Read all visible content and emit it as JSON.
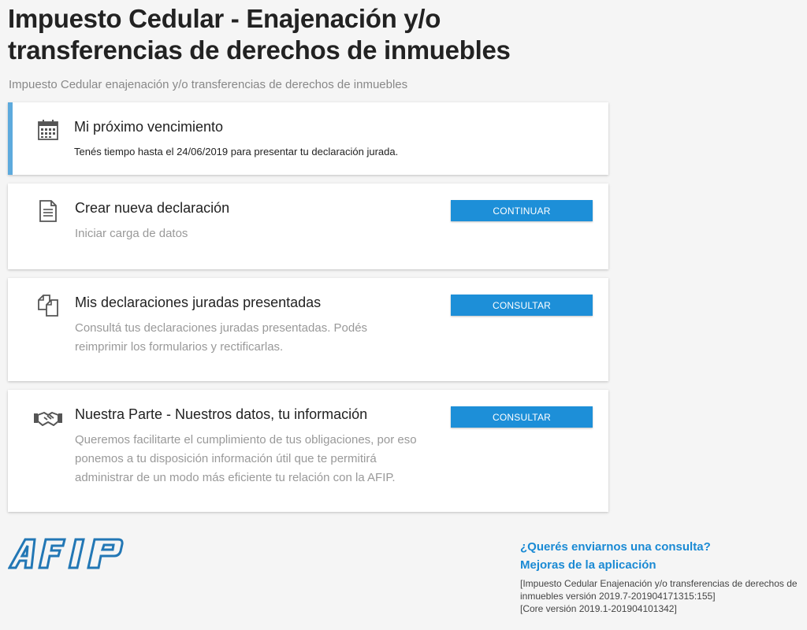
{
  "page": {
    "title": "Impuesto Cedular - Enajenación y/o transferencias de derechos de inmuebles",
    "subtitle": "Impuesto Cedular enajenación y/o transferencias de derechos de inmuebles"
  },
  "cards": [
    {
      "icon": "calendar-icon",
      "title": "Mi próximo vencimiento",
      "description": "Tenés tiempo hasta el 24/06/2019 para presentar tu declaración jurada."
    },
    {
      "icon": "document-icon",
      "title": "Crear nueva declaración",
      "description": "Iniciar carga de datos",
      "button": "CONTINUAR"
    },
    {
      "icon": "copy-documents-icon",
      "title": "Mis declaraciones juradas presentadas",
      "description": "Consultá tus declaraciones juradas presentadas. Podés reimprimir los formularios y rectificarlas.",
      "button": "CONSULTAR"
    },
    {
      "icon": "handshake-icon",
      "title": "Nuestra Parte - Nuestros datos, tu información",
      "description": "Queremos facilitarte el cumplimiento de tus obligaciones, por eso ponemos a tu disposición información útil que te permitirá administrar de un modo más eficiente tu relación con la AFIP.",
      "button": "CONSULTAR"
    }
  ],
  "footer": {
    "logo_text": "AFIP",
    "consulta_link": "¿Querés enviarnos una consulta?",
    "mejoras_link": "Mejoras de la aplicación",
    "version_line1": "[Impuesto Cedular Enajenación y/o transferencias de derechos de inmuebles versión 2019.7-201904171315:155]",
    "version_line2": "[Core versión 2019.1-201904101342]"
  },
  "colors": {
    "accent": "#5daadd",
    "button": "#1d8fd8",
    "link": "#1a8ad4",
    "logo": "#2277b5"
  }
}
